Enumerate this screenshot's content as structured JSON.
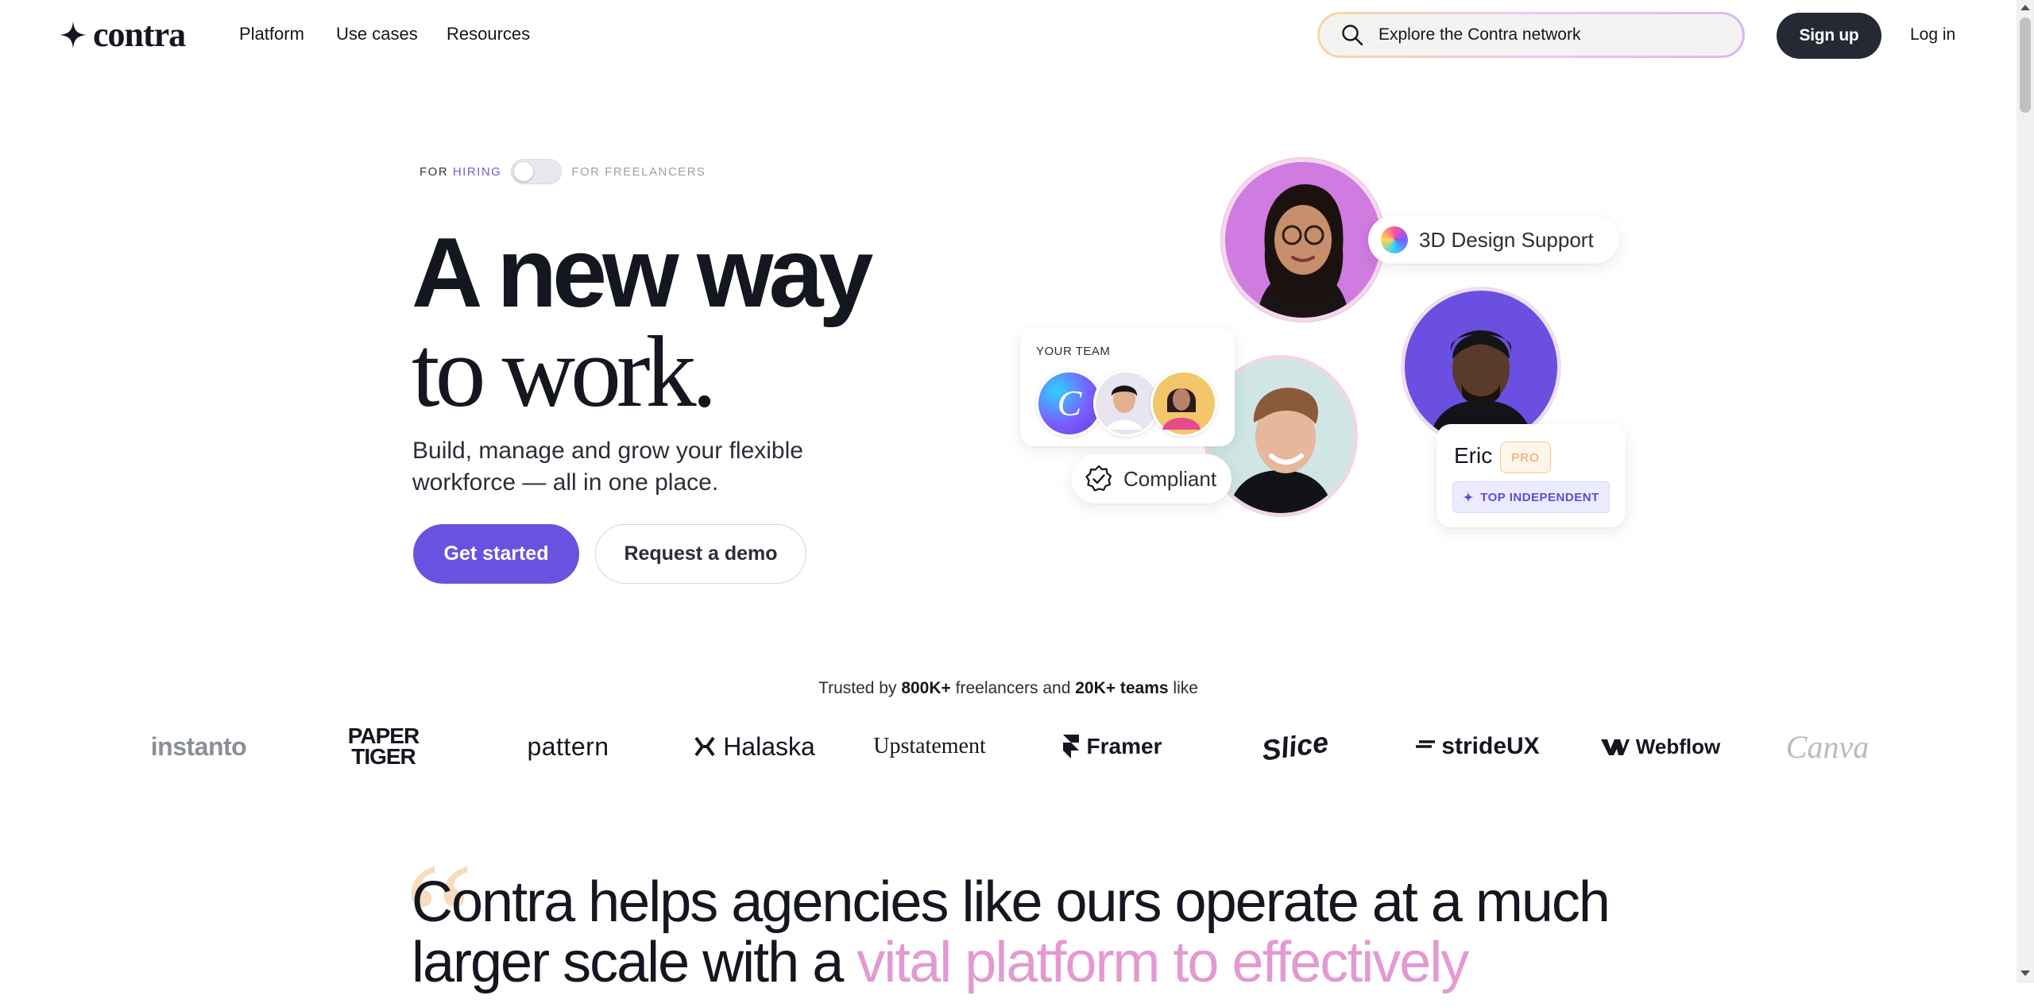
{
  "nav": {
    "brand": "contra",
    "links": [
      "Platform",
      "Use cases",
      "Resources"
    ],
    "search_placeholder": "Explore the Contra network",
    "signup": "Sign up",
    "login": "Log in"
  },
  "hero": {
    "toggle": {
      "for": "FOR",
      "hiring": "HIRING",
      "freelancers": "FOR FREELANCERS"
    },
    "headline_1": "A new way",
    "headline_2": "to work.",
    "subtitle": "Build, manage and grow your flexible workforce — all in one place.",
    "cta_primary": "Get started",
    "cta_secondary": "Request a demo",
    "art": {
      "skill_pill": "3D Design Support",
      "team_label": "YOUR TEAM",
      "compliant": "Compliant",
      "eric_name": "Eric",
      "pro_badge": "PRO",
      "top_badge": "TOP INDEPENDENT"
    }
  },
  "trusted": {
    "prefix": "Trusted by ",
    "freelancers": "800K+",
    "mid": " freelancers and ",
    "teams": "20K+ teams",
    "suffix": " like"
  },
  "logos": [
    "instanto",
    "PAPER TIGER",
    "pattern",
    "Halaska",
    "Upstatement",
    "Framer",
    "Slice",
    "strideUX",
    "Webflow",
    "Canva"
  ],
  "quote": {
    "text_plain": "Contra helps agencies like ours operate at a much larger scale with a ",
    "text_highlight": "vital platform to effectively"
  },
  "colors": {
    "primary": "#6b51e0",
    "dark": "#242933",
    "highlight": "#e39ad0"
  }
}
